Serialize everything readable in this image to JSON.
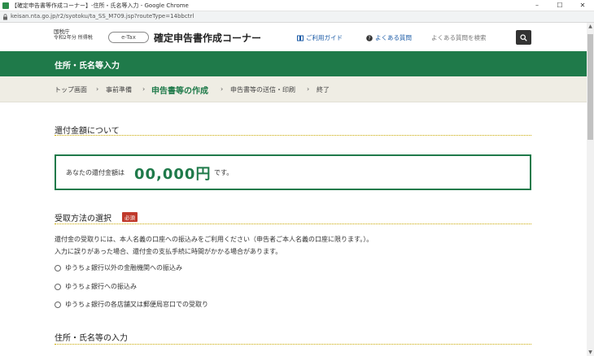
{
  "browser": {
    "window_title": "【確定申告書等作成コーナー】-住所・氏名等入力 - Google Chrome",
    "url": "keisan.nta.go.jp/r2/syotoku/ta_SS_M709.jsp?routeType=14bbctrl",
    "window_buttons": {
      "minimize": "–",
      "maximize": "☐",
      "close": "✕"
    }
  },
  "header": {
    "agency_line1": "国税庁",
    "agency_line2": "令和2年分 所得税",
    "logo_text": "e-Tax",
    "site_title": "確定申告書作成コーナー",
    "help_link": "ご利用ガイド",
    "faq_link": "よくある質問",
    "search_label": "よくある質問を検索"
  },
  "green_band": {
    "heading": "住所・氏名等入力"
  },
  "breadcrumb": {
    "items": [
      "トップ画面",
      "事前準備",
      "申告書等の作成",
      "申告書等の送信・印刷",
      "終了"
    ],
    "active_index": 2
  },
  "main": {
    "refund_section_title": "還付金額について",
    "refund_pre": "あなたの還付金額は",
    "refund_amount": "00,000円",
    "refund_post": "です。",
    "receive_section_title": "受取方法の選択",
    "required_badge": "必須",
    "note_line1": "還付金の受取りには、本人名義の口座への振込みをご利用ください（申告者ご本人名義の口座に限ります。）。",
    "note_line2": "入力に誤りがあった場合、還付金の支払手続に時間がかかる場合があります。",
    "options": [
      "ゆうちょ銀行以外の金融機関への振込み",
      "ゆうちょ銀行への振込み",
      "ゆうちょ銀行の各店舗又は郵便局窓口での受取り"
    ],
    "address_section_title": "住所・氏名等の入力"
  },
  "colors": {
    "brand_green": "#1f7a4a",
    "breadcrumb_bg": "#efede4",
    "required_red": "#c0392b",
    "dotted_gold": "#c9a800"
  }
}
